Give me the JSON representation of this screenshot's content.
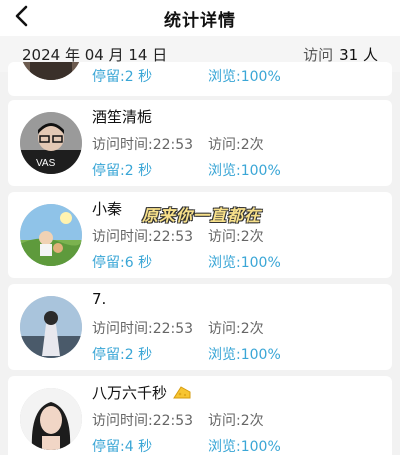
{
  "header": {
    "title": "统计详情",
    "back_icon": "chevron-left-icon"
  },
  "stats": {
    "date": "2024 年 04 月 14 日",
    "visit_label": "访问",
    "visit_count": "31 人"
  },
  "partial_item": {
    "stay": "停留:2 秒",
    "browse": "浏览:100%"
  },
  "visitors": [
    {
      "name": "酒笙清栀",
      "time": "访问时间:22:53",
      "count": "访问:2次",
      "stay": "停留:2 秒",
      "browse": "浏览:100%"
    },
    {
      "name": "小秦",
      "sticker": "原来你一直都在",
      "time": "访问时间:22:53",
      "count": "访问:2次",
      "stay": "停留:6 秒",
      "browse": "浏览:100%"
    },
    {
      "name": "7.",
      "time": "访问时间:22:53",
      "count": "访问:2次",
      "stay": "停留:2 秒",
      "browse": "浏览:100%"
    },
    {
      "name": "八万六千秒",
      "name_emoji": "cheese-icon",
      "time": "访问时间:22:53",
      "count": "访问:2次",
      "stay": "停留:4 秒",
      "browse": "浏览:100%"
    }
  ],
  "colors": {
    "accent": "#3aa6d6",
    "muted": "#666666",
    "background": "#f2f2f2"
  }
}
